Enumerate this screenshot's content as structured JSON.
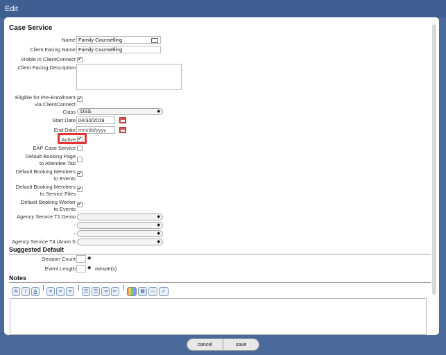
{
  "window": {
    "title": "Edit"
  },
  "case_service": {
    "title": "Case Service",
    "name_label": "Name",
    "name_value": "Family Counselling",
    "client_facing_name_label": "Client Facing Name",
    "client_facing_name_value": "Family Counselling",
    "visible_label": "Visible in ClientConnect",
    "visible_checked": true,
    "description_label": "Client Facing Description",
    "description_value": "",
    "eligible_label_1": "Eligible for Pre-Enrollment",
    "eligible_label_2": "via ClientConnect",
    "eligible_checked": true,
    "class_label": "Class",
    "class_value": "DSS",
    "start_date_label": "Start Date",
    "start_date_value": "04/30/2019",
    "end_date_label": "End Date",
    "end_date_placeholder": "mm/dd/yyyy",
    "active_label": "Active",
    "active_checked": true,
    "eap_label": "EAP Case Service",
    "eap_checked": false,
    "booking_page_label_1": "Default Booking Page",
    "booking_page_label_2": "to Attendee Tab",
    "booking_page_checked": false,
    "booking_members_events_label_1": "Default Booking Members",
    "booking_members_events_label_2": "to Events",
    "booking_members_events_checked": true,
    "booking_members_files_label_1": "Default Booking Members",
    "booking_members_files_label_2": "to Service Files",
    "booking_members_files_checked": true,
    "booking_worker_label_1": "Default Booking Worker",
    "booking_worker_label_2": "to Events",
    "booking_worker_checked": true,
    "agency_t1_label": "Agency Service T1 Demo",
    "dash_label_1": "-",
    "dash_label_2": "-",
    "agency_t4_label": "Agency Service T4 (Anon S"
  },
  "suggested_default": {
    "title": "Suggested Default",
    "session_count_label": "Session Count",
    "event_length_label": "Event Length",
    "event_length_unit": "minute(s)"
  },
  "notes": {
    "title": "Notes",
    "toolbar_icons": [
      "bold-icon",
      "italic-icon",
      "underline-icon",
      "align-left-icon",
      "align-center-icon",
      "align-right-icon",
      "bulleted-list-icon",
      "numbered-list-icon",
      "indent-icon",
      "outdent-icon",
      "color-icon",
      "table-icon",
      "link-icon",
      "spellcheck-icon"
    ]
  },
  "footer": {
    "cancel_label": "cancel",
    "save_label": "save"
  }
}
